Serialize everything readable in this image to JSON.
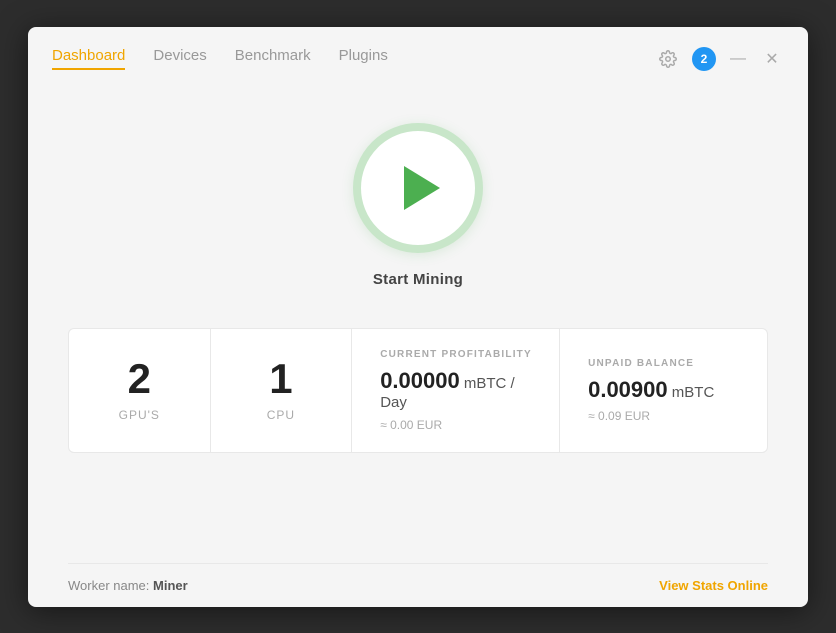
{
  "window": {
    "background_color": "#2d2d2d",
    "app_bg": "#f5f5f5"
  },
  "nav": {
    "tabs": [
      {
        "id": "dashboard",
        "label": "Dashboard",
        "active": true
      },
      {
        "id": "devices",
        "label": "Devices",
        "active": false
      },
      {
        "id": "benchmark",
        "label": "Benchmark",
        "active": false
      },
      {
        "id": "plugins",
        "label": "Plugins",
        "active": false
      }
    ]
  },
  "controls": {
    "notification_count": "2",
    "minimize_symbol": "—",
    "close_symbol": "✕"
  },
  "play_button": {
    "label": "Start Mining"
  },
  "stats": {
    "gpus": {
      "value": "2",
      "label": "GPU'S"
    },
    "cpu": {
      "value": "1",
      "label": "CPU"
    },
    "profitability": {
      "section_label": "CURRENT PROFITABILITY",
      "main_value": "0.00000",
      "unit": " mBTC / Day",
      "sub_value": "≈ 0.00 EUR"
    },
    "balance": {
      "section_label": "UNPAID BALANCE",
      "main_value": "0.00900",
      "unit": " mBTC",
      "sub_value": "≈ 0.09 EUR"
    }
  },
  "footer": {
    "worker_label": "Worker name:",
    "worker_name": "Miner",
    "view_stats_label": "View Stats Online"
  }
}
